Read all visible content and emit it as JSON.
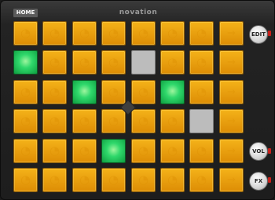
{
  "header": {
    "home_label": "HOME",
    "brand": "novation"
  },
  "side_buttons": {
    "edit_label": "EDIT",
    "vol_label": "VOL",
    "fx_label": "FX"
  },
  "grid": {
    "rows": 6,
    "cols": 8,
    "pads": [
      [
        "orange",
        "orange",
        "orange",
        "orange",
        "orange",
        "orange",
        "orange",
        "orange"
      ],
      [
        "green",
        "orange",
        "orange",
        "orange",
        "gray",
        "orange",
        "orange",
        "orange"
      ],
      [
        "orange",
        "orange",
        "green",
        "orange",
        "orange",
        "green",
        "orange",
        "orange"
      ],
      [
        "orange",
        "orange",
        "orange",
        "orange",
        "orange",
        "orange",
        "gray",
        "orange"
      ],
      [
        "orange",
        "orange",
        "orange",
        "green",
        "orange",
        "orange",
        "orange",
        "orange"
      ],
      [
        "orange",
        "orange",
        "orange",
        "orange",
        "orange",
        "orange",
        "orange",
        "orange"
      ]
    ]
  },
  "colors": {
    "orange": "#f0a712",
    "green": "#2fd86b",
    "gray": "#bcbcbc",
    "led_red": "#c8201a"
  }
}
